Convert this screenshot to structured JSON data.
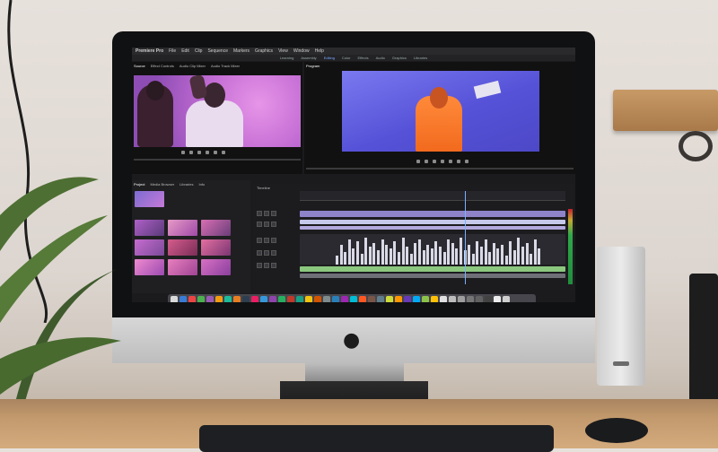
{
  "app": {
    "menu": [
      "Premiere Pro",
      "File",
      "Edit",
      "Clip",
      "Sequence",
      "Markers",
      "Graphics",
      "View",
      "Window",
      "Help"
    ],
    "workspaces": [
      "Learning",
      "Assembly",
      "Editing",
      "Color",
      "Effects",
      "Audio",
      "Graphics",
      "Libraries"
    ],
    "active_workspace": "Editing"
  },
  "source_monitor": {
    "tabs": [
      "Source",
      "Effect Controls",
      "Audio Clip Mixer",
      "Audio Track Mixer"
    ]
  },
  "program_monitor": {
    "tabs": [
      "Program"
    ]
  },
  "project_panel": {
    "tabs": [
      "Project",
      "Media Browser",
      "Libraries",
      "Info"
    ]
  },
  "timeline": {
    "tabs": [
      "Timeline"
    ]
  },
  "colors": {
    "video_clip": "#8e83c9",
    "video_clip_alt": "#c6c9e9",
    "audio_clip": "#8cc77f",
    "timecode": "#e8c65a",
    "playhead": "#7ab0ff",
    "source_frame": "#c770d6",
    "program_frame": "#5652d8",
    "shelf_wood": "#b8864f"
  },
  "icons": [
    "apple-logo-icon",
    "dock-app-icons",
    "transport-play-icon"
  ]
}
